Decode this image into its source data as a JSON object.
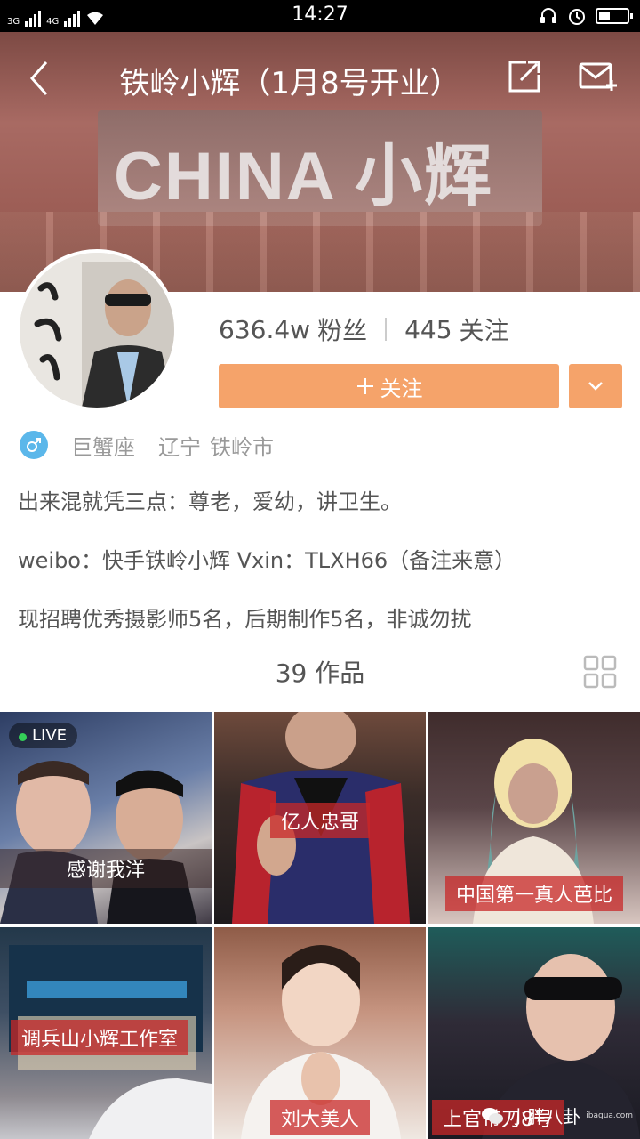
{
  "status_bar": {
    "network_1": "3G",
    "network_2": "4G",
    "time": "14:27"
  },
  "header": {
    "title": "铁岭小辉（1月8号开业）",
    "banner_sign": "CHINA 小辉",
    "icons": [
      "back-icon",
      "share-icon",
      "mail-icon"
    ]
  },
  "profile": {
    "fans_count": "636.4w",
    "fans_label": "粉丝",
    "following_count": "445",
    "following_label": "关注",
    "follow_button": "关注",
    "zodiac": "巨蟹座",
    "province": "辽宁",
    "city": "铁岭市",
    "avatar_calligraphy": "铁岭小辉",
    "bio_lines": [
      "出来混就凭三点：尊老，爱幼，讲卫生。",
      "weibo：快手铁岭小辉  Vxin：TLXH66（备注来意）",
      "现招聘优秀摄影师5名，后期制作5名，非诚勿扰"
    ]
  },
  "works": {
    "count_label": "39 作品",
    "items": [
      {
        "caption": "感谢我洋",
        "live": "LIVE"
      },
      {
        "caption": "亿人忠哥"
      },
      {
        "caption": "中国第一真人芭比"
      },
      {
        "caption": "调兵山小辉工作室"
      },
      {
        "caption": "刘大美人"
      },
      {
        "caption": "上官带刀8号"
      }
    ]
  },
  "watermark": {
    "text": "小胖八卦",
    "small": "ibagua.com"
  },
  "colors": {
    "accent": "#f5a36a",
    "gender_badge": "#5bb7ea"
  }
}
